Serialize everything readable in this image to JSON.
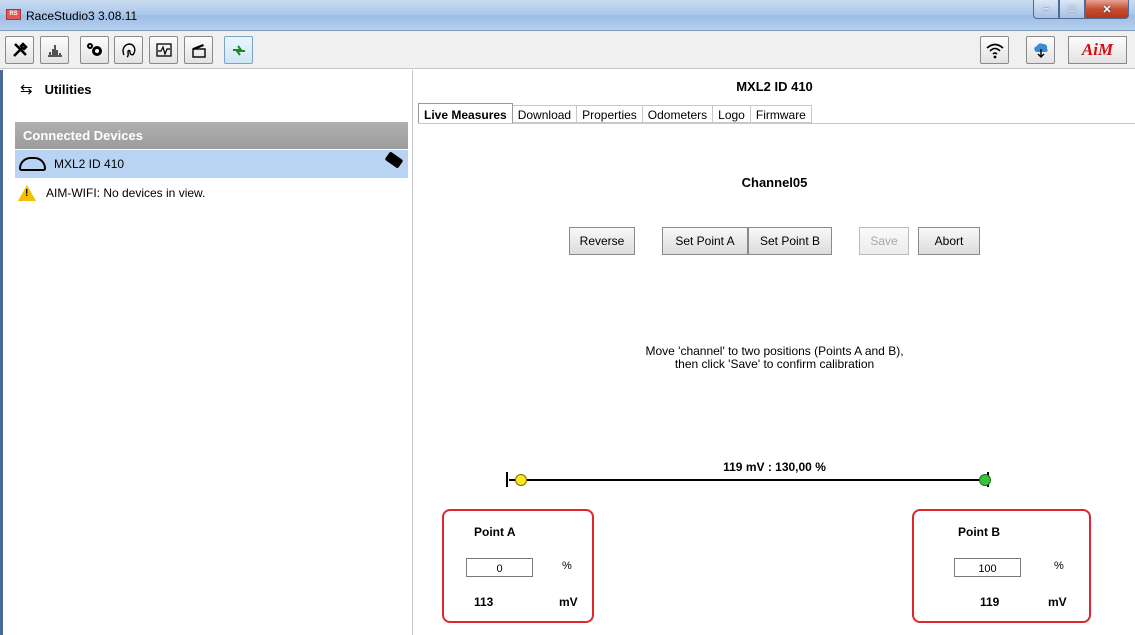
{
  "window": {
    "title": "RaceStudio3 3.08.11"
  },
  "toolbar": {
    "left_icons": [
      "tools-icon",
      "chart-icon",
      "gear-icon",
      "fingerprint-icon",
      "waveform-icon",
      "clapper-icon",
      "sync-icon"
    ],
    "right_icons": [
      "wifi-icon",
      "cloud-icon"
    ],
    "logo": "AiM"
  },
  "sidebar": {
    "utilities_label": "Utilities",
    "connected_header": "Connected Devices",
    "device_label": "MXL2 ID 410",
    "wifi_message": "AIM-WIFI: No devices in view."
  },
  "main": {
    "device_title": "MXL2 ID 410",
    "tabs": [
      {
        "label": "Live Measures",
        "active": true
      },
      {
        "label": "Download"
      },
      {
        "label": "Properties"
      },
      {
        "label": "Odometers"
      },
      {
        "label": "Logo"
      },
      {
        "label": "Firmware"
      }
    ],
    "channel_title": "Channel05",
    "buttons": {
      "reverse": "Reverse",
      "set_a": "Set Point A",
      "set_b": "Set Point B",
      "save": "Save",
      "abort": "Abort"
    },
    "instruction_line1": "Move 'channel' to two positions (Points A and B),",
    "instruction_line2": "then click 'Save' to confirm calibration",
    "readout": "119 mV  :  130,00 %",
    "point_a": {
      "title": "Point A",
      "percent": "0",
      "percent_unit": "%",
      "mv": "113",
      "mv_unit": "mV"
    },
    "point_b": {
      "title": "Point B",
      "percent": "100",
      "percent_unit": "%",
      "mv": "119",
      "mv_unit": "mV"
    }
  }
}
